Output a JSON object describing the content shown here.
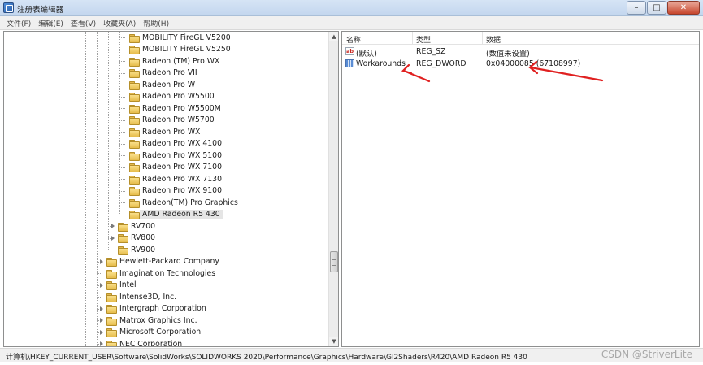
{
  "window": {
    "title": "注册表编辑器",
    "min_icon": "minimize-icon",
    "max_icon": "maximize-icon",
    "close_icon": "close-icon",
    "min_glyph": "–",
    "max_glyph": "□",
    "close_glyph": "✕"
  },
  "menu": [
    "文件(F)",
    "编辑(E)",
    "查看(V)",
    "收藏夹(A)",
    "帮助(H)"
  ],
  "tree": {
    "items": [
      {
        "label": "MOBILITY FireGL V5200",
        "level": 3,
        "expandable": false
      },
      {
        "label": "MOBILITY FireGL V5250",
        "level": 3,
        "expandable": false
      },
      {
        "label": "Radeon (TM) Pro WX",
        "level": 3,
        "expandable": false
      },
      {
        "label": "Radeon Pro VII",
        "level": 3,
        "expandable": false
      },
      {
        "label": "Radeon Pro W",
        "level": 3,
        "expandable": false
      },
      {
        "label": "Radeon Pro W5500",
        "level": 3,
        "expandable": false
      },
      {
        "label": "Radeon Pro W5500M",
        "level": 3,
        "expandable": false
      },
      {
        "label": "Radeon Pro W5700",
        "level": 3,
        "expandable": false
      },
      {
        "label": "Radeon Pro WX",
        "level": 3,
        "expandable": false
      },
      {
        "label": "Radeon Pro WX 4100",
        "level": 3,
        "expandable": false
      },
      {
        "label": "Radeon Pro WX 5100",
        "level": 3,
        "expandable": false
      },
      {
        "label": "Radeon Pro WX 7100",
        "level": 3,
        "expandable": false
      },
      {
        "label": "Radeon Pro WX 7130",
        "level": 3,
        "expandable": false
      },
      {
        "label": "Radeon Pro WX 9100",
        "level": 3,
        "expandable": false
      },
      {
        "label": "Radeon(TM) Pro Graphics",
        "level": 3,
        "expandable": false
      },
      {
        "label": "AMD Radeon R5 430",
        "level": 3,
        "expandable": false,
        "selected": true
      },
      {
        "label": "RV700",
        "level": 2,
        "expandable": true
      },
      {
        "label": "RV800",
        "level": 2,
        "expandable": true
      },
      {
        "label": "RV900",
        "level": 2,
        "expandable": false
      },
      {
        "label": "Hewlett-Packard Company",
        "level": 1,
        "expandable": true
      },
      {
        "label": "Imagination Technologies",
        "level": 1,
        "expandable": false
      },
      {
        "label": "Intel",
        "level": 1,
        "expandable": true
      },
      {
        "label": "Intense3D, Inc.",
        "level": 1,
        "expandable": false
      },
      {
        "label": "Intergraph Corporation",
        "level": 1,
        "expandable": true
      },
      {
        "label": "Matrox Graphics Inc.",
        "level": 1,
        "expandable": true
      },
      {
        "label": "Microsoft Corporation",
        "level": 1,
        "expandable": true
      },
      {
        "label": "NEC Corporation",
        "level": 1,
        "expandable": true
      }
    ]
  },
  "list": {
    "columns": [
      "名称",
      "类型",
      "数据"
    ],
    "rows": [
      {
        "name": "(默认)",
        "type": "REG_SZ",
        "data": "(数值未设置)",
        "icon": "string-value-icon"
      },
      {
        "name": "Workarounds",
        "type": "REG_DWORD",
        "data": "0x04000085 (67108997)",
        "icon": "dword-value-icon"
      }
    ]
  },
  "annotation_color": "#e02020",
  "status": {
    "path": "计算机\\HKEY_CURRENT_USER\\Software\\SolidWorks\\SOLIDWORKS 2020\\Performance\\Graphics\\Hardware\\Gl2Shaders\\R420\\AMD Radeon R5 430",
    "watermark": "CSDN @StriverLite"
  }
}
